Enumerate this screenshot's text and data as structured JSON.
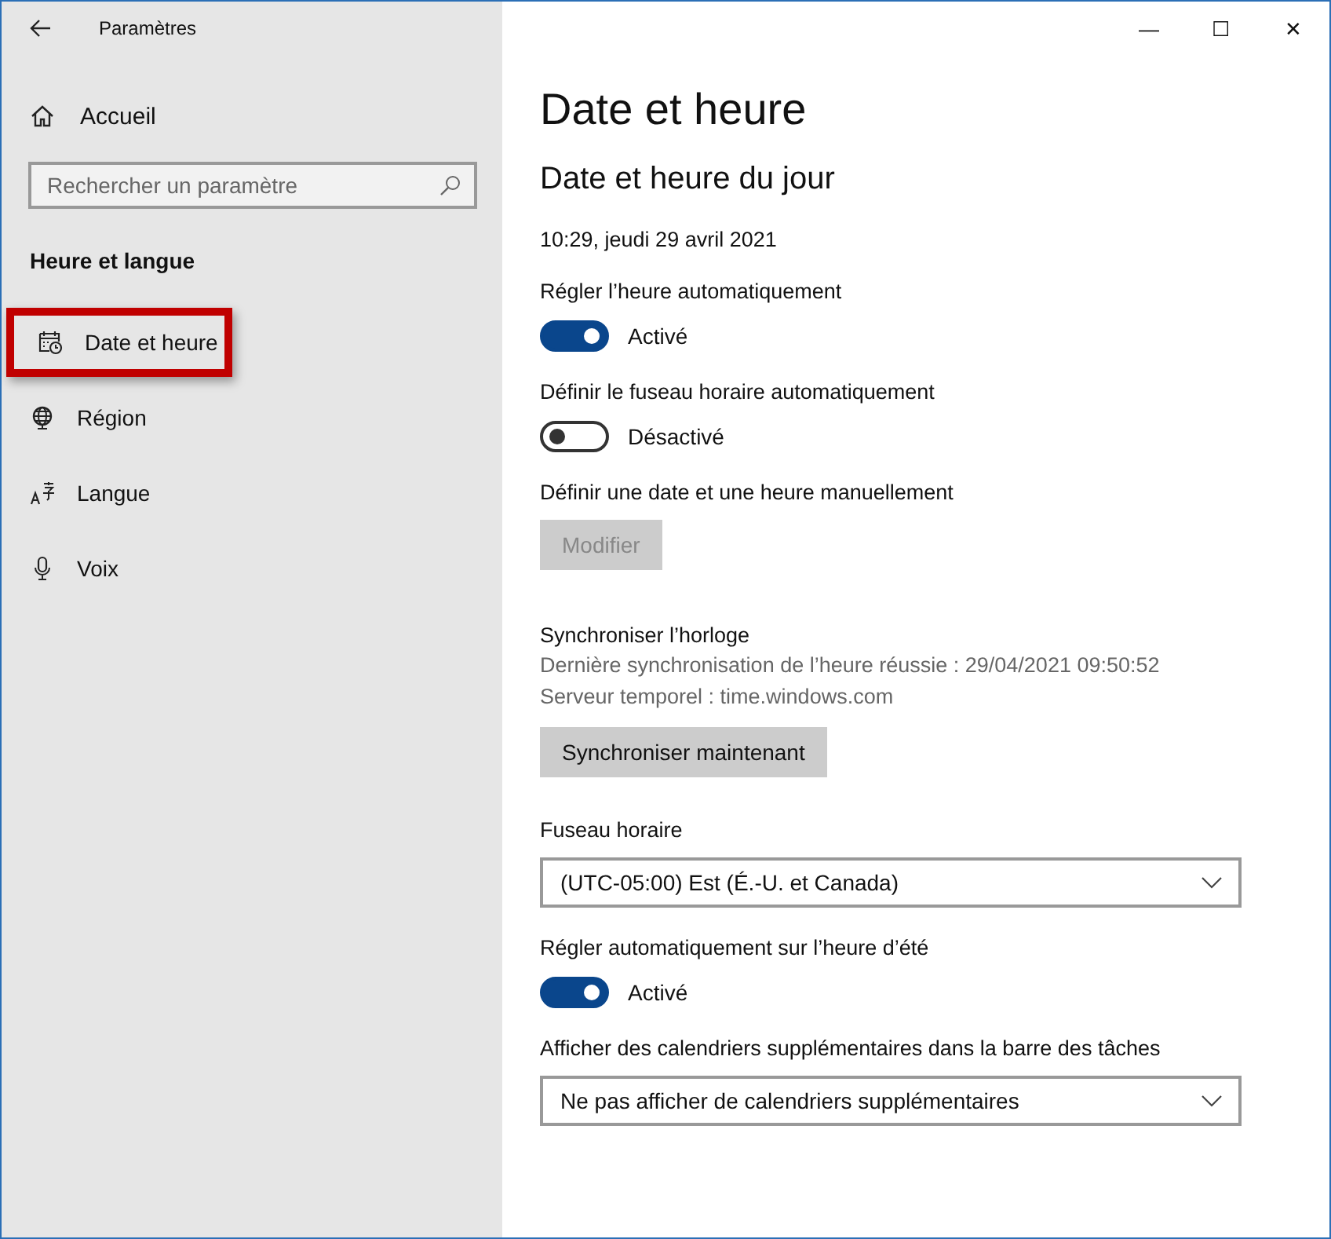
{
  "window": {
    "title": "Paramètres",
    "controls": [
      "—",
      "☐",
      "✕"
    ]
  },
  "sidebar": {
    "home": "Accueil",
    "search": {
      "placeholder": "Rechercher un paramètre"
    },
    "heading": "Heure et langue",
    "items": [
      {
        "label": "Date et heure",
        "selected": true
      },
      {
        "label": "Région",
        "selected": false
      },
      {
        "label": "Langue",
        "selected": false
      },
      {
        "label": "Voix",
        "selected": false
      }
    ]
  },
  "page": {
    "title": "Date et heure",
    "subtitle": "Date et heure du jour",
    "sections": [
      {
        "kind": "text",
        "text": "10:29, jeudi 29 avril 2021"
      },
      {
        "kind": "toggle",
        "label": "Régler l’heure automatiquement",
        "on": true,
        "state": "Activé"
      },
      {
        "kind": "toggle",
        "label": "Définir le fuseau horaire automatiquement",
        "on": false,
        "state": "Désactivé"
      },
      {
        "kind": "button",
        "label": "Définir une date et une heure manuellement",
        "button": "Modifier",
        "disabled": true
      },
      {
        "kind": "sync",
        "label": "Synchroniser l’horloge",
        "lines": [
          "Dernière synchronisation de l’heure réussie : 29/04/2021 09:50:52",
          "Serveur temporel : time.windows.com"
        ],
        "button": "Synchroniser maintenant",
        "disabled": false
      },
      {
        "kind": "dropdown",
        "label": "Fuseau horaire",
        "value": "(UTC-05:00) Est (É.-U. et Canada)"
      },
      {
        "kind": "toggle",
        "label": "Régler automatiquement sur l’heure d’été",
        "on": true,
        "state": "Activé"
      },
      {
        "kind": "dropdown",
        "label": "Afficher des calendriers supplémentaires dans la barre des tâches",
        "value": "Ne pas afficher de calendriers supplémentaires"
      }
    ]
  }
}
